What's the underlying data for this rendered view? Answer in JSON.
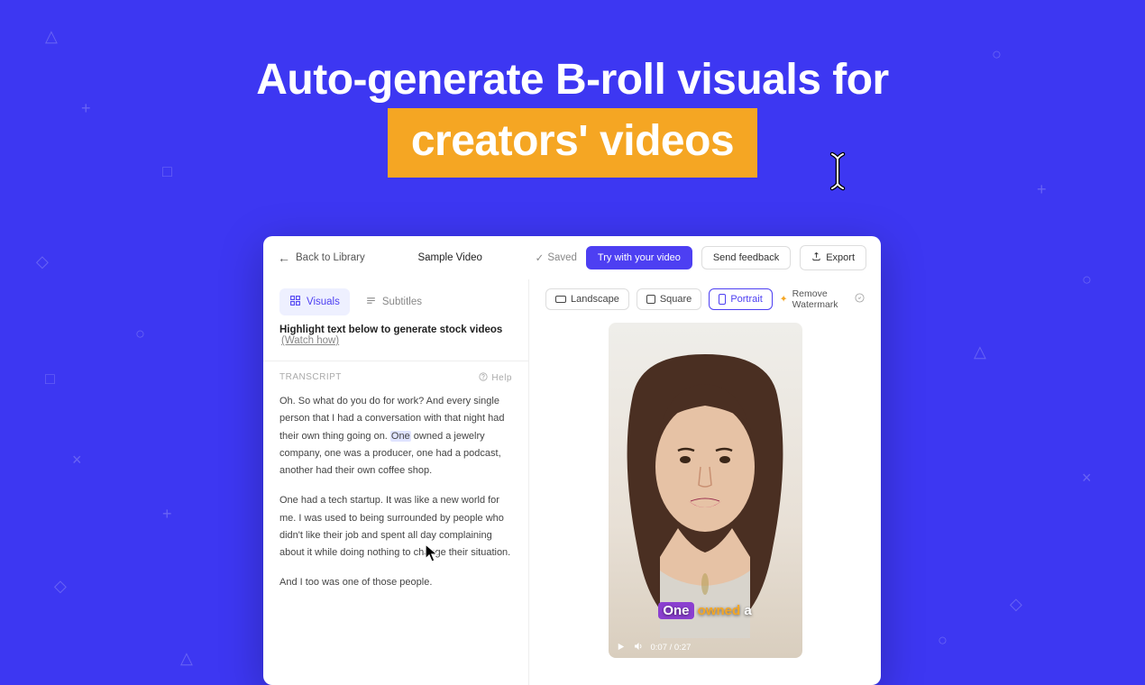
{
  "hero": {
    "line1": "Auto-generate B-roll visuals for",
    "highlighted": "creators' videos"
  },
  "topbar": {
    "back": "Back to Library",
    "title": "Sample Video",
    "saved": "Saved",
    "try_btn": "Try with your video",
    "feedback_btn": "Send feedback",
    "export_btn": "Export"
  },
  "tabs": {
    "visuals": "Visuals",
    "subtitles": "Subtitles"
  },
  "instruct": {
    "main": "Highlight text below to generate stock videos",
    "watch": "(Watch how)"
  },
  "transcript": {
    "label": "TRANSCRIPT",
    "help": "Help",
    "p1a": "Oh. So what do you do for work? And every single person that I had a conversation with that night had their own thing going on. ",
    "p1_highlight": "One",
    "p1b": " owned a jewelry company, one was a producer, one had a podcast, another had their own coffee shop.",
    "p2": "One had a tech startup. It was like a new world for me. I was used to being surrounded by people who didn't like their job and spent all day complaining about it while doing nothing to change their situation.",
    "p3": "And I too was one of those people."
  },
  "aspect": {
    "landscape": "Landscape",
    "square": "Square",
    "portrait": "Portrait",
    "watermark": "Remove Watermark"
  },
  "caption": {
    "w1": "One",
    "w2": "owned",
    "w3": "a"
  },
  "playbar": {
    "time": "0:07 / 0:27"
  }
}
